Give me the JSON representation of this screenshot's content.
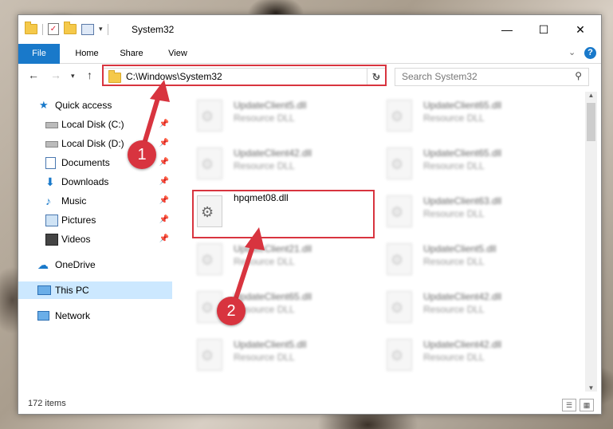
{
  "window": {
    "title": "System32"
  },
  "window_controls": {
    "minimize": "—",
    "maximize": "☐",
    "close": "✕"
  },
  "ribbon": {
    "tabs": [
      "File",
      "Home",
      "Share",
      "View"
    ]
  },
  "address": {
    "path": "C:\\Windows\\System32",
    "search_placeholder": "Search System32"
  },
  "sidebar": {
    "quick_access": "Quick access",
    "items": [
      {
        "label": "Local Disk (C:)",
        "icon": "drive-icon"
      },
      {
        "label": "Local Disk (D:)",
        "icon": "drive-icon"
      },
      {
        "label": "Documents",
        "icon": "documents-icon"
      },
      {
        "label": "Downloads",
        "icon": "downloads-icon"
      },
      {
        "label": "Music",
        "icon": "music-icon"
      },
      {
        "label": "Pictures",
        "icon": "pictures-icon"
      },
      {
        "label": "Videos",
        "icon": "videos-icon"
      }
    ],
    "onedrive": "OneDrive",
    "this_pc": "This PC",
    "network": "Network"
  },
  "files": {
    "col1": [
      {
        "name": "UpdateClient5.dll",
        "type": "Resource DLL"
      },
      {
        "name": "UpdateClient42.dll",
        "type": "Resource DLL"
      },
      {
        "name": "hpqmet08.dll",
        "type": ""
      },
      {
        "name": "UpdateClient21.dll",
        "type": "Resource DLL"
      },
      {
        "name": "UpdateClient65.dll",
        "type": "Resource DLL"
      },
      {
        "name": "UpdateClient5.dll",
        "type": "Resource DLL"
      }
    ],
    "col2": [
      {
        "name": "UpdateClient65.dll",
        "type": "Resource DLL"
      },
      {
        "name": "UpdateClient65.dll",
        "type": "Resource DLL"
      },
      {
        "name": "UpdateClient63.dll",
        "type": "Resource DLL"
      },
      {
        "name": "UpdateClient5.dll",
        "type": "Resource DLL"
      },
      {
        "name": "UpdateClient42.dll",
        "type": "Resource DLL"
      },
      {
        "name": "UpdateClient42.dll",
        "type": "Resource DLL"
      }
    ]
  },
  "status": {
    "items": "172 items"
  },
  "annotations": {
    "step1": "1",
    "step2": "2",
    "color": "#d8343f"
  }
}
